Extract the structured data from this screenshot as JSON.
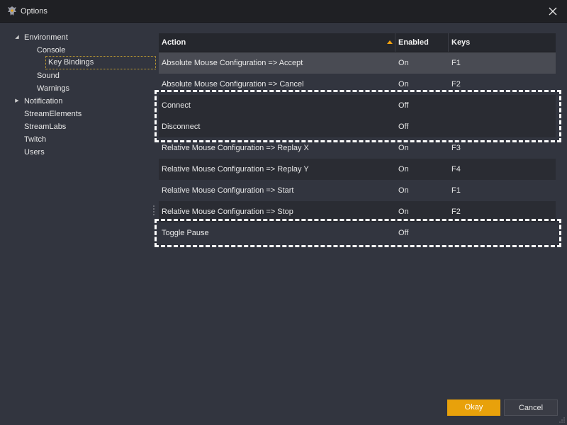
{
  "window": {
    "title": "Options",
    "icons": {
      "app": "dragon-logo-icon",
      "close": "close-icon"
    }
  },
  "tree": {
    "items": [
      {
        "label": "Environment",
        "level": 0,
        "expander": "expanded"
      },
      {
        "label": "Console",
        "level": 1
      },
      {
        "label": "Key Bindings",
        "level": 1,
        "selected": true
      },
      {
        "label": "Sound",
        "level": 1
      },
      {
        "label": "Warnings",
        "level": 1
      },
      {
        "label": "Notification",
        "level": 0,
        "expander": "collapsed"
      },
      {
        "label": "StreamElements",
        "level": 0
      },
      {
        "label": "StreamLabs",
        "level": 0
      },
      {
        "label": "Twitch",
        "level": 0
      },
      {
        "label": "Users",
        "level": 0
      }
    ]
  },
  "grid": {
    "columns": {
      "action": "Action",
      "enabled": "Enabled",
      "keys": "Keys"
    },
    "sort": {
      "column": "action",
      "direction": "ascending"
    },
    "rows": [
      {
        "action": "Absolute Mouse Configuration => Accept",
        "enabled": "On",
        "keys": "F1",
        "selected": true
      },
      {
        "action": "Absolute Mouse Configuration => Cancel",
        "enabled": "On",
        "keys": "F2"
      },
      {
        "action": "Connect",
        "enabled": "Off",
        "keys": ""
      },
      {
        "action": "Disconnect",
        "enabled": "Off",
        "keys": ""
      },
      {
        "action": "Relative Mouse Configuration => Replay X",
        "enabled": "On",
        "keys": "F3"
      },
      {
        "action": "Relative Mouse Configuration => Replay Y",
        "enabled": "On",
        "keys": "F4"
      },
      {
        "action": "Relative Mouse Configuration => Start",
        "enabled": "On",
        "keys": "F1"
      },
      {
        "action": "Relative Mouse Configuration => Stop",
        "enabled": "On",
        "keys": "F2"
      },
      {
        "action": "Toggle Pause",
        "enabled": "Off",
        "keys": ""
      }
    ]
  },
  "buttons": {
    "okay": "Okay",
    "cancel": "Cancel"
  },
  "colors": {
    "accent": "#e8a10b",
    "background": "#32353f",
    "titlebar": "#1f2024",
    "highlight_outline": "#ffffff"
  }
}
